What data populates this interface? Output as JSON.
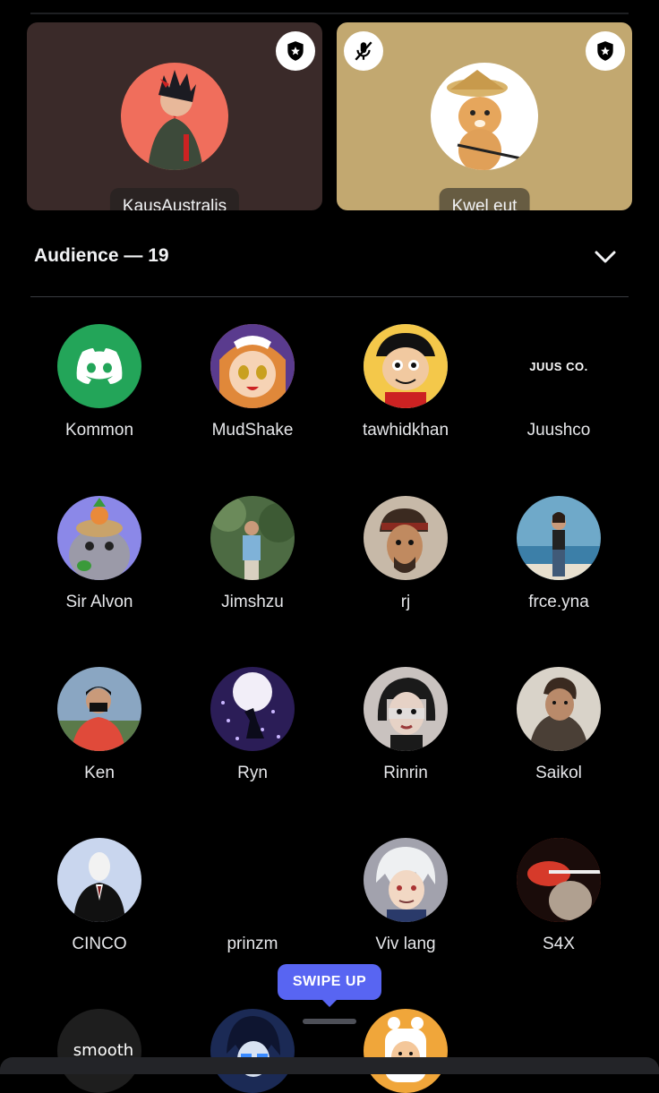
{
  "speakers": [
    {
      "name": "KausAustralis",
      "bg": "#3a2a29",
      "avatar_bg": "#f06e5c",
      "moderator": true,
      "muted": false
    },
    {
      "name": "Kwel eut",
      "bg": "#c2a870",
      "avatar_bg": "#ffffff",
      "moderator": true,
      "muted": true
    }
  ],
  "audience": {
    "title": "Audience — 19",
    "members": [
      {
        "name": "Kommon",
        "icon": "discord-logo-icon",
        "avatar_bg": "#23a559"
      },
      {
        "name": "MudShake",
        "avatar_bg": "#e0883a"
      },
      {
        "name": "tawhidkhan",
        "avatar_bg": "#4a8fd6"
      },
      {
        "name": "Juushco",
        "avatar_bg": "#000000",
        "avatar_text": "JUUS CO."
      },
      {
        "name": "Sir Alvon",
        "avatar_bg": "#8b88e8"
      },
      {
        "name": "Jimshzu",
        "avatar_bg": "#4d6b43"
      },
      {
        "name": "rj",
        "avatar_bg": "#c7b9a8"
      },
      {
        "name": "frce.yna",
        "avatar_bg": "#6fa9c9"
      },
      {
        "name": "Ken",
        "avatar_bg": "#8aa6c2"
      },
      {
        "name": "Ryn",
        "avatar_bg": "#2b1d57"
      },
      {
        "name": "Rinrin",
        "avatar_bg": "#c9c2bf"
      },
      {
        "name": "Saikol",
        "avatar_bg": "#d9d3c9"
      },
      {
        "name": "CINCO",
        "avatar_bg": "#c9d6ee"
      },
      {
        "name": "prinzm",
        "avatar_bg": "#000000"
      },
      {
        "name": "Viv lang",
        "avatar_bg": "#a2a2ad"
      },
      {
        "name": "S4X",
        "avatar_bg": "#c23a2c"
      },
      {
        "name": "",
        "avatar_bg": "#1e1e1e",
        "avatar_text": "_smooth"
      },
      {
        "name": "",
        "avatar_bg": "#1b2a55"
      },
      {
        "name": "",
        "avatar_bg": "#f0a63a"
      }
    ]
  },
  "swipe_hint": "SWIPE UP",
  "colors": {
    "accent": "#5865f2",
    "discord_green": "#23a559"
  }
}
